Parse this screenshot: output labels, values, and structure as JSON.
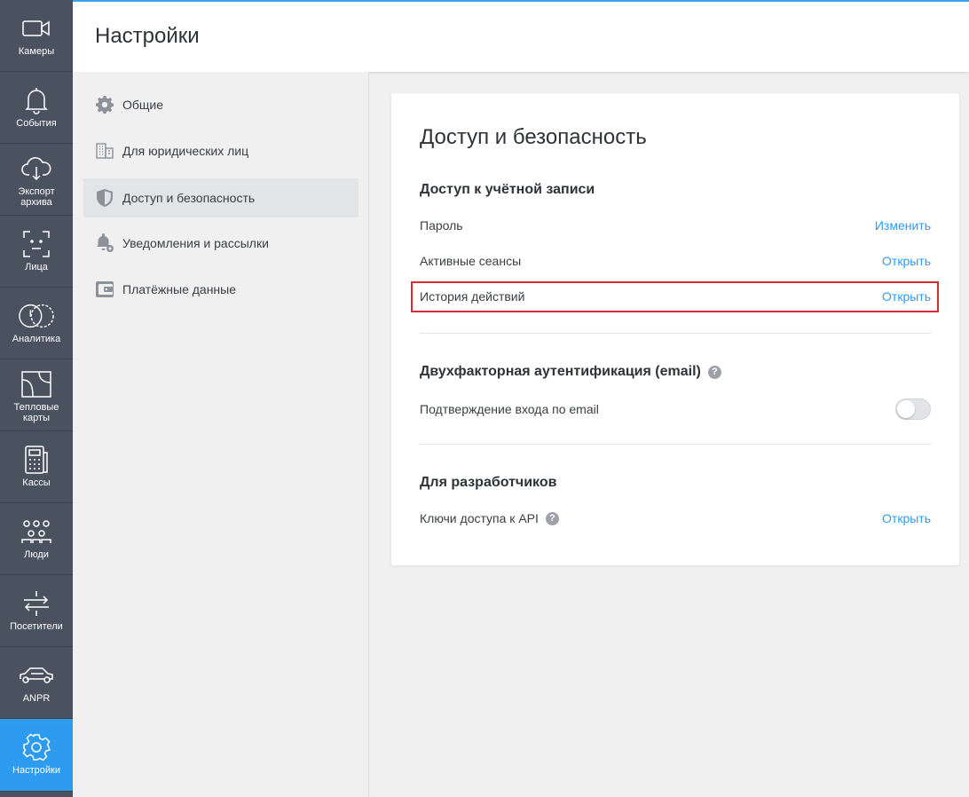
{
  "rail": {
    "items": [
      {
        "label": "Камеры",
        "icon": "camera-icon"
      },
      {
        "label": "События",
        "icon": "bell-icon"
      },
      {
        "label": "Экспорт\nархива",
        "icon": "cloud-download-icon"
      },
      {
        "label": "Лица",
        "icon": "face-frame-icon"
      },
      {
        "label": "Аналитика",
        "icon": "analytics-icon"
      },
      {
        "label": "Тепловые\nкарты",
        "icon": "heatmap-icon"
      },
      {
        "label": "Кассы",
        "icon": "cash-register-icon"
      },
      {
        "label": "Люди",
        "icon": "people-icon"
      },
      {
        "label": "Посетители",
        "icon": "visitors-arrows-icon"
      },
      {
        "label": "ANPR",
        "icon": "car-icon"
      },
      {
        "label": "Настройки",
        "icon": "gear-icon"
      }
    ]
  },
  "header": {
    "title": "Настройки"
  },
  "settings_nav": {
    "items": [
      {
        "label": "Общие",
        "icon": "gear-icon"
      },
      {
        "label": "Для юридических лиц",
        "icon": "building-icon"
      },
      {
        "label": "Доступ и безопасность",
        "icon": "shield-icon"
      },
      {
        "label": "Уведомления и рассылки",
        "icon": "bell-settings-icon"
      },
      {
        "label": "Платёжные данные",
        "icon": "wallet-icon"
      }
    ]
  },
  "card": {
    "title": "Доступ и безопасность",
    "account_access": {
      "title": "Доступ к учётной записи",
      "password_label": "Пароль",
      "password_action": "Изменить",
      "sessions_label": "Активные сеансы",
      "sessions_action": "Открыть",
      "history_label": "История действий",
      "history_action": "Открыть"
    },
    "two_factor": {
      "title": "Двухфакторная аутентификация (email)",
      "help": "?",
      "email_confirm_label": "Подтверждение входа по email",
      "enabled": false
    },
    "developers": {
      "title": "Для разработчиков",
      "api_keys_label": "Ключи доступа к API",
      "help": "?",
      "api_keys_action": "Открыть"
    }
  },
  "colors": {
    "accent": "#2d9bf0",
    "rail_bg": "#4a5260",
    "highlight": "#dc2a33"
  }
}
